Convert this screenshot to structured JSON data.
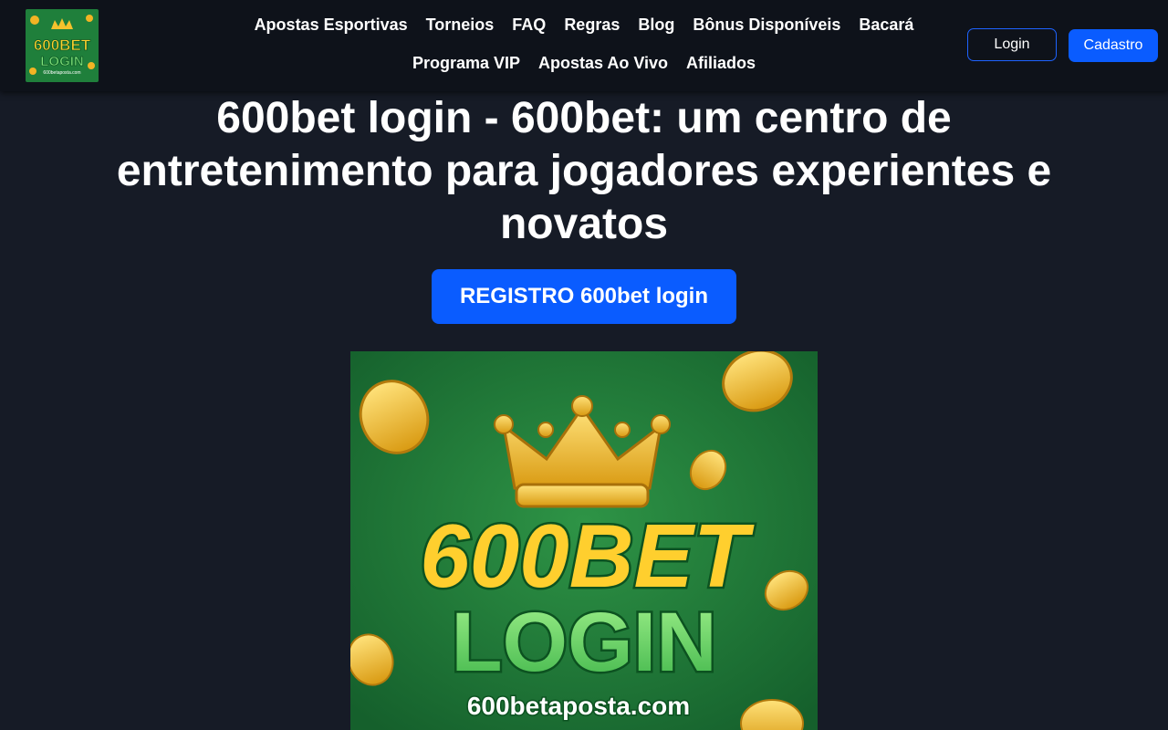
{
  "header": {
    "logo": {
      "line1": "600BET",
      "line2": "LOGIN",
      "domain": "600betaposta.com"
    },
    "nav_row1": [
      "Apostas Esportivas",
      "Torneios",
      "FAQ",
      "Regras",
      "Blog",
      "Bônus Disponíveis",
      "Bacará"
    ],
    "nav_row2": [
      "Programa VIP",
      "Apostas Ao Vivo",
      "Afiliados"
    ],
    "login_label": "Login",
    "signup_label": "Cadastro"
  },
  "main": {
    "title": "600bet login - 600bet: um centro de entretenimento para jogadores experientes e novatos",
    "cta_label": "REGISTRO 600bet login",
    "hero": {
      "line1": "600BET",
      "line2": "LOGIN",
      "domain": "600betaposta.com"
    }
  },
  "colors": {
    "background": "#161b26",
    "header": "#0e121a",
    "accent": "#0a5cff",
    "hero_green": "#1e7a3a",
    "gold": "#f5c22c"
  }
}
